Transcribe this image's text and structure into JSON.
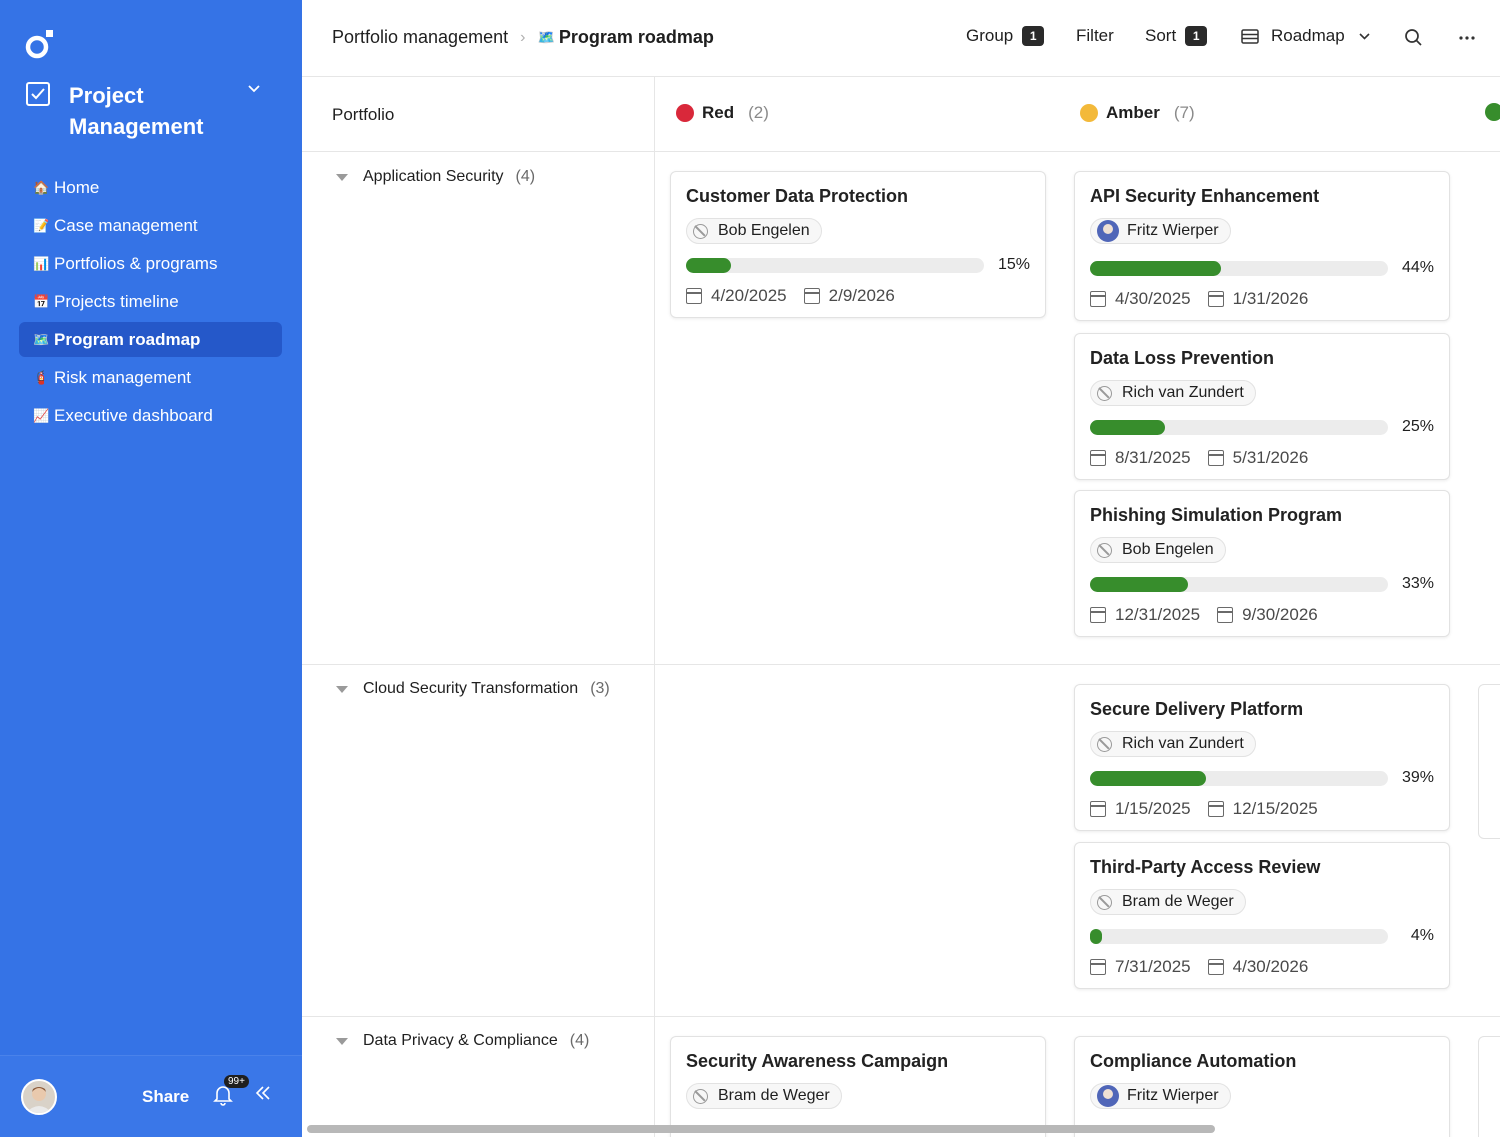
{
  "sidebar": {
    "workspace_title": "Project Management",
    "nav": [
      {
        "emoji": "🏠",
        "label": "Home"
      },
      {
        "emoji": "📝",
        "label": "Case management"
      },
      {
        "emoji": "📊",
        "label": "Portfolios & programs"
      },
      {
        "emoji": "📅",
        "label": "Projects timeline"
      },
      {
        "emoji": "🗺️",
        "label": "Program roadmap"
      },
      {
        "emoji": "🧯",
        "label": "Risk management"
      },
      {
        "emoji": "📈",
        "label": "Executive dashboard"
      }
    ],
    "share_label": "Share",
    "notif_badge": "99+"
  },
  "topbar": {
    "crumb_parent": "Portfolio management",
    "crumb_current_emoji": "🗺️",
    "crumb_current": "Program roadmap",
    "group_label": "Group",
    "group_count": "1",
    "filter_label": "Filter",
    "sort_label": "Sort",
    "sort_count": "1",
    "view_label": "Roadmap"
  },
  "board": {
    "portfolio_header": "Portfolio",
    "statuses": [
      {
        "name": "Red",
        "count": "(2)",
        "color": "#d9283a"
      },
      {
        "name": "Amber",
        "count": "(7)",
        "color": "#f3b93a"
      },
      {
        "name": "",
        "count": "",
        "color": "#378d2c"
      }
    ],
    "groups": [
      {
        "name": "Application Security",
        "count": "(4)"
      },
      {
        "name": "Cloud Security Transformation",
        "count": "(3)"
      },
      {
        "name": "Data Privacy & Compliance",
        "count": "(4)"
      }
    ],
    "cards": [
      {
        "title": "Customer Data Protection",
        "owner": "Bob Engelen",
        "progress": 15,
        "pct": "15%",
        "start": "4/20/2025",
        "end": "2/9/2026"
      },
      {
        "title": "API Security Enhancement",
        "owner": "Fritz Wierper",
        "progress": 44,
        "pct": "44%",
        "start": "4/30/2025",
        "end": "1/31/2026"
      },
      {
        "title": "Data Loss Prevention",
        "owner": "Rich van Zundert",
        "progress": 25,
        "pct": "25%",
        "start": "8/31/2025",
        "end": "5/31/2026"
      },
      {
        "title": "Phishing Simulation Program",
        "owner": "Bob Engelen",
        "progress": 33,
        "pct": "33%",
        "start": "12/31/2025",
        "end": "9/30/2026"
      },
      {
        "title": "Secure Delivery Platform",
        "owner": "Rich van Zundert",
        "progress": 39,
        "pct": "39%",
        "start": "1/15/2025",
        "end": "12/15/2025"
      },
      {
        "title": "Third-Party Access Review",
        "owner": "Bram de Weger",
        "progress": 4,
        "pct": "4%",
        "start": "7/31/2025",
        "end": "4/30/2026"
      },
      {
        "title": "Security Awareness Campaign",
        "owner": "Bram de Weger"
      },
      {
        "title": "Compliance Automation",
        "owner": "Fritz Wierper"
      }
    ]
  }
}
